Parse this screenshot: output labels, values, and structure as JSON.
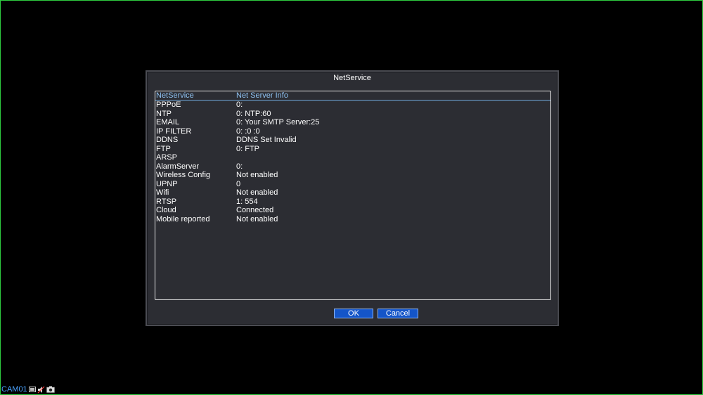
{
  "dialog": {
    "title": "NetService",
    "header": {
      "col1": "NetService",
      "col2": "Net Server Info"
    },
    "rows": [
      {
        "name": "PPPoE",
        "info": "0:"
      },
      {
        "name": "NTP",
        "info": "0: NTP:60"
      },
      {
        "name": "EMAIL",
        "info": "0: Your SMTP Server:25"
      },
      {
        "name": "IP FILTER",
        "info": "0: :0 :0"
      },
      {
        "name": "DDNS",
        "info": "DDNS Set Invalid"
      },
      {
        "name": "FTP",
        "info": "0: FTP"
      },
      {
        "name": "ARSP",
        "info": ""
      },
      {
        "name": "AlarmServer",
        "info": "0:"
      },
      {
        "name": "Wireless Config",
        "info": "Not enabled"
      },
      {
        "name": "UPNP",
        "info": "0"
      },
      {
        "name": "Wifi",
        "info": "Not enabled"
      },
      {
        "name": "RTSP",
        "info": "1: 554"
      },
      {
        "name": "Cloud",
        "info": "Connected"
      },
      {
        "name": "Mobile reported",
        "info": "Not enabled"
      }
    ],
    "ok_label": "OK",
    "cancel_label": "Cancel"
  },
  "camera": {
    "label": "CAM01",
    "icons": [
      "record-icon",
      "audio-icon",
      "camera-icon"
    ]
  }
}
